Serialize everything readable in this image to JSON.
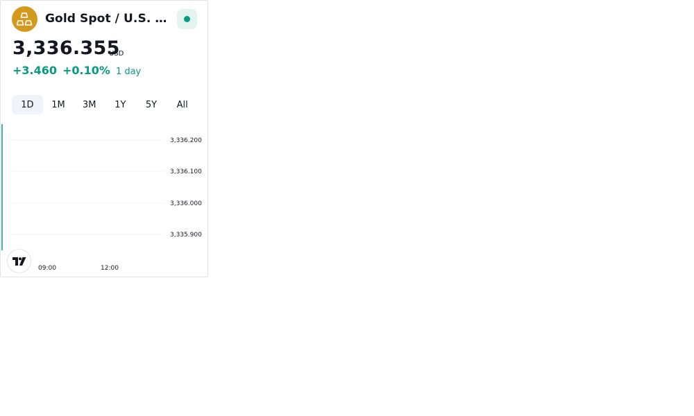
{
  "widget": {
    "symbol": "Gold Spot / U.S. Dollar",
    "logo_icon": "gold-bars-icon",
    "status_icon": "market-open-dot-icon",
    "price": "3,336.355",
    "currency": "USD",
    "change_abs": "+3.460",
    "change_pct": "+0.10%",
    "period": "1 day",
    "tabs": [
      "1D",
      "1M",
      "3M",
      "1Y",
      "5Y",
      "All"
    ],
    "active_tab": "1D",
    "branding_icon": "tradingview-logo-icon"
  },
  "colors": {
    "positive": "#089981",
    "logo_bg": "#d49a1f",
    "active_tab_bg": "#f0f3fa",
    "grid": "#f0f3fa"
  },
  "chart_data": {
    "type": "line",
    "y_ticks": [
      "3,336.200",
      "3,336.100",
      "3,336.000",
      "3,335.900"
    ],
    "x_ticks": [
      "09:00",
      "12:00"
    ],
    "grid": true
  }
}
